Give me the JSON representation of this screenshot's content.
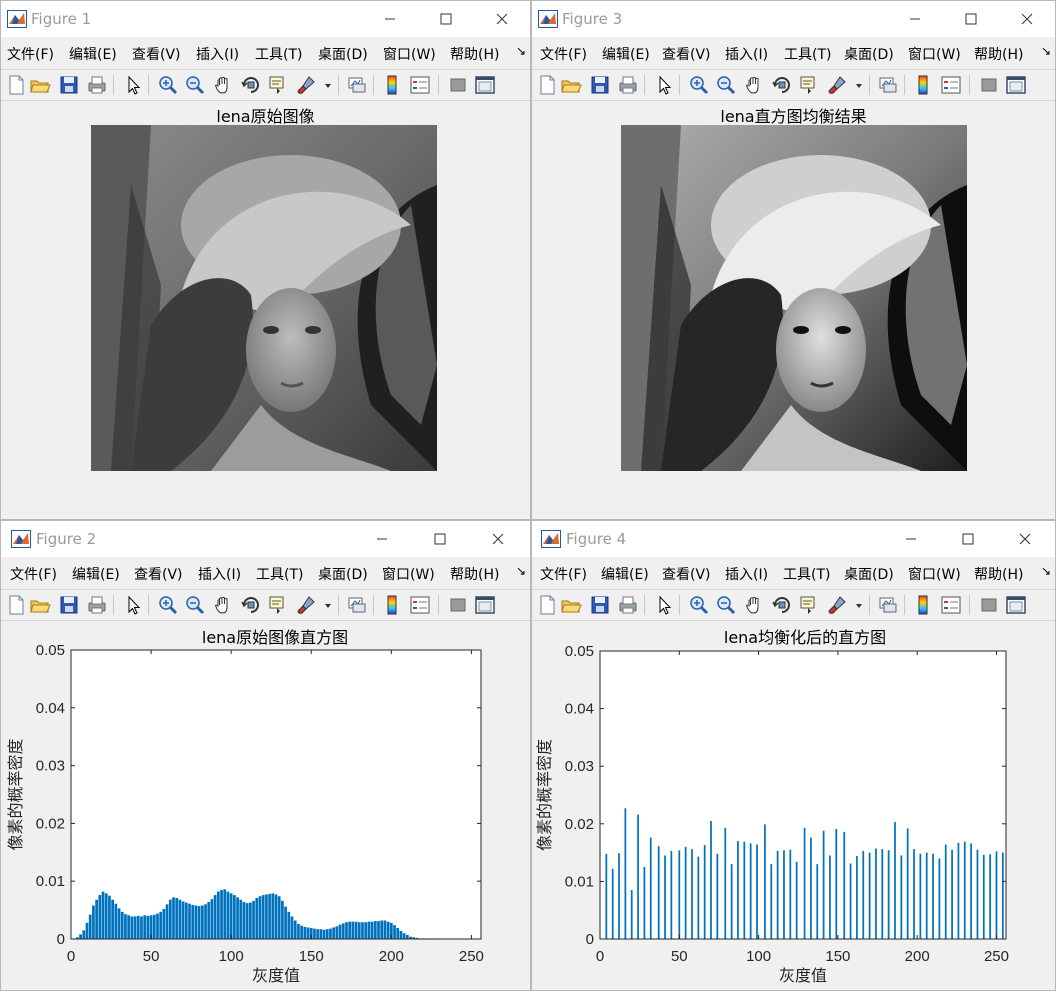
{
  "menu": [
    "文件(F)",
    "编辑(E)",
    "查看(V)",
    "插入(I)",
    "工具(T)",
    "桌面(D)",
    "窗口(W)",
    "帮助(H)"
  ],
  "figure1": {
    "window_title": "Figure 1",
    "axes_title": "lena原始图像"
  },
  "figure3": {
    "window_title": "Figure 3",
    "axes_title": "lena直方图均衡结果"
  },
  "figure2": {
    "window_title": "Figure 2",
    "axes_title": "lena原始图像直方图"
  },
  "figure4": {
    "window_title": "Figure 4",
    "axes_title": "lena均衡化后的直方图"
  },
  "chart_data": [
    {
      "type": "bar",
      "title": "lena原始图像直方图",
      "xlabel": "灰度值",
      "ylabel": "像素的概率密度",
      "xlim": [
        0,
        256
      ],
      "ylim": [
        0,
        0.05
      ],
      "xticks": [
        0,
        50,
        100,
        150,
        200,
        250
      ],
      "yticks": [
        0,
        0.01,
        0.02,
        0.03,
        0.04,
        0.05
      ],
      "ytick_labels": [
        "0",
        "0.01",
        "0.02",
        "0.03",
        "0.04",
        "0.05"
      ],
      "color": "#0072bd",
      "bins_x": [
        4,
        6,
        8,
        10,
        12,
        14,
        16,
        18,
        20,
        22,
        24,
        26,
        28,
        30,
        32,
        34,
        36,
        38,
        40,
        42,
        44,
        46,
        48,
        50,
        52,
        54,
        56,
        58,
        60,
        62,
        64,
        66,
        68,
        70,
        72,
        74,
        76,
        78,
        80,
        82,
        84,
        86,
        88,
        90,
        92,
        94,
        96,
        98,
        100,
        102,
        104,
        106,
        108,
        110,
        112,
        114,
        116,
        118,
        120,
        122,
        124,
        126,
        128,
        130,
        132,
        134,
        136,
        138,
        140,
        142,
        144,
        146,
        148,
        150,
        152,
        154,
        156,
        158,
        160,
        162,
        164,
        166,
        168,
        170,
        172,
        174,
        176,
        178,
        180,
        182,
        184,
        186,
        188,
        190,
        192,
        194,
        196,
        198,
        200,
        202,
        204,
        206,
        208,
        210,
        212,
        214,
        216,
        218,
        220,
        222,
        224,
        226
      ],
      "values": [
        0.0003,
        0.0008,
        0.0015,
        0.0028,
        0.0042,
        0.0058,
        0.0068,
        0.0076,
        0.0082,
        0.0079,
        0.0075,
        0.0068,
        0.0061,
        0.0053,
        0.0047,
        0.0043,
        0.0041,
        0.0039,
        0.0039,
        0.004,
        0.0039,
        0.0041,
        0.004,
        0.0041,
        0.0042,
        0.0044,
        0.0047,
        0.0052,
        0.006,
        0.0068,
        0.0072,
        0.0071,
        0.0068,
        0.0065,
        0.0063,
        0.0061,
        0.0059,
        0.0058,
        0.0057,
        0.0058,
        0.006,
        0.0064,
        0.0069,
        0.0076,
        0.0082,
        0.0085,
        0.0086,
        0.0082,
        0.0079,
        0.0076,
        0.0072,
        0.0068,
        0.0064,
        0.0062,
        0.0063,
        0.0066,
        0.0071,
        0.0074,
        0.0076,
        0.0077,
        0.0078,
        0.0079,
        0.0077,
        0.0074,
        0.0066,
        0.0056,
        0.0047,
        0.0039,
        0.0032,
        0.0026,
        0.0023,
        0.0021,
        0.002,
        0.0019,
        0.0018,
        0.0017,
        0.0017,
        0.0016,
        0.0017,
        0.0018,
        0.002,
        0.0022,
        0.0025,
        0.0027,
        0.0029,
        0.003,
        0.003,
        0.003,
        0.0029,
        0.0029,
        0.0029,
        0.003,
        0.003,
        0.0031,
        0.0031,
        0.0032,
        0.0032,
        0.003,
        0.0028,
        0.0024,
        0.0019,
        0.0014,
        0.001,
        0.0007,
        0.0004,
        0.0003,
        0.0002,
        0.0001,
        0.0001,
        0.0001,
        0.0001,
        0.0001
      ]
    },
    {
      "type": "bar",
      "title": "lena均衡化后的直方图",
      "xlabel": "灰度值",
      "ylabel": "像素的概率密度",
      "xlim": [
        0,
        256
      ],
      "ylim": [
        0,
        0.05
      ],
      "xticks": [
        0,
        50,
        100,
        150,
        200,
        250
      ],
      "yticks": [
        0,
        0.01,
        0.02,
        0.03,
        0.04,
        0.05
      ],
      "ytick_labels": [
        "0",
        "0.01",
        "0.02",
        "0.03",
        "0.04",
        "0.05"
      ],
      "color": "#0072bd",
      "bins_x": [
        4,
        8,
        12,
        16,
        20,
        24,
        28,
        32,
        37,
        41,
        45,
        50,
        54,
        58,
        62,
        66,
        70,
        74,
        79,
        83,
        87,
        91,
        95,
        99,
        104,
        108,
        112,
        116,
        120,
        124,
        129,
        133,
        137,
        141,
        145,
        149,
        154,
        158,
        162,
        166,
        170,
        174,
        178,
        182,
        186,
        190,
        194,
        198,
        202,
        206,
        210,
        214,
        218,
        222,
        226,
        230,
        234,
        238,
        242,
        246,
        250,
        254
      ],
      "values": [
        0.0148,
        0.0122,
        0.0149,
        0.0227,
        0.0085,
        0.0216,
        0.0125,
        0.0176,
        0.0161,
        0.0145,
        0.0153,
        0.0154,
        0.016,
        0.0156,
        0.0143,
        0.0163,
        0.0205,
        0.0148,
        0.0193,
        0.013,
        0.017,
        0.0169,
        0.0166,
        0.0164,
        0.0199,
        0.013,
        0.0153,
        0.0154,
        0.0155,
        0.0134,
        0.0193,
        0.0176,
        0.013,
        0.0188,
        0.0145,
        0.0191,
        0.0186,
        0.0131,
        0.0144,
        0.0153,
        0.015,
        0.0157,
        0.0156,
        0.0154,
        0.0203,
        0.0145,
        0.0192,
        0.0156,
        0.0148,
        0.015,
        0.0148,
        0.014,
        0.0164,
        0.0155,
        0.0167,
        0.0169,
        0.0166,
        0.0155,
        0.0146,
        0.0147,
        0.0152,
        0.015
      ]
    }
  ]
}
